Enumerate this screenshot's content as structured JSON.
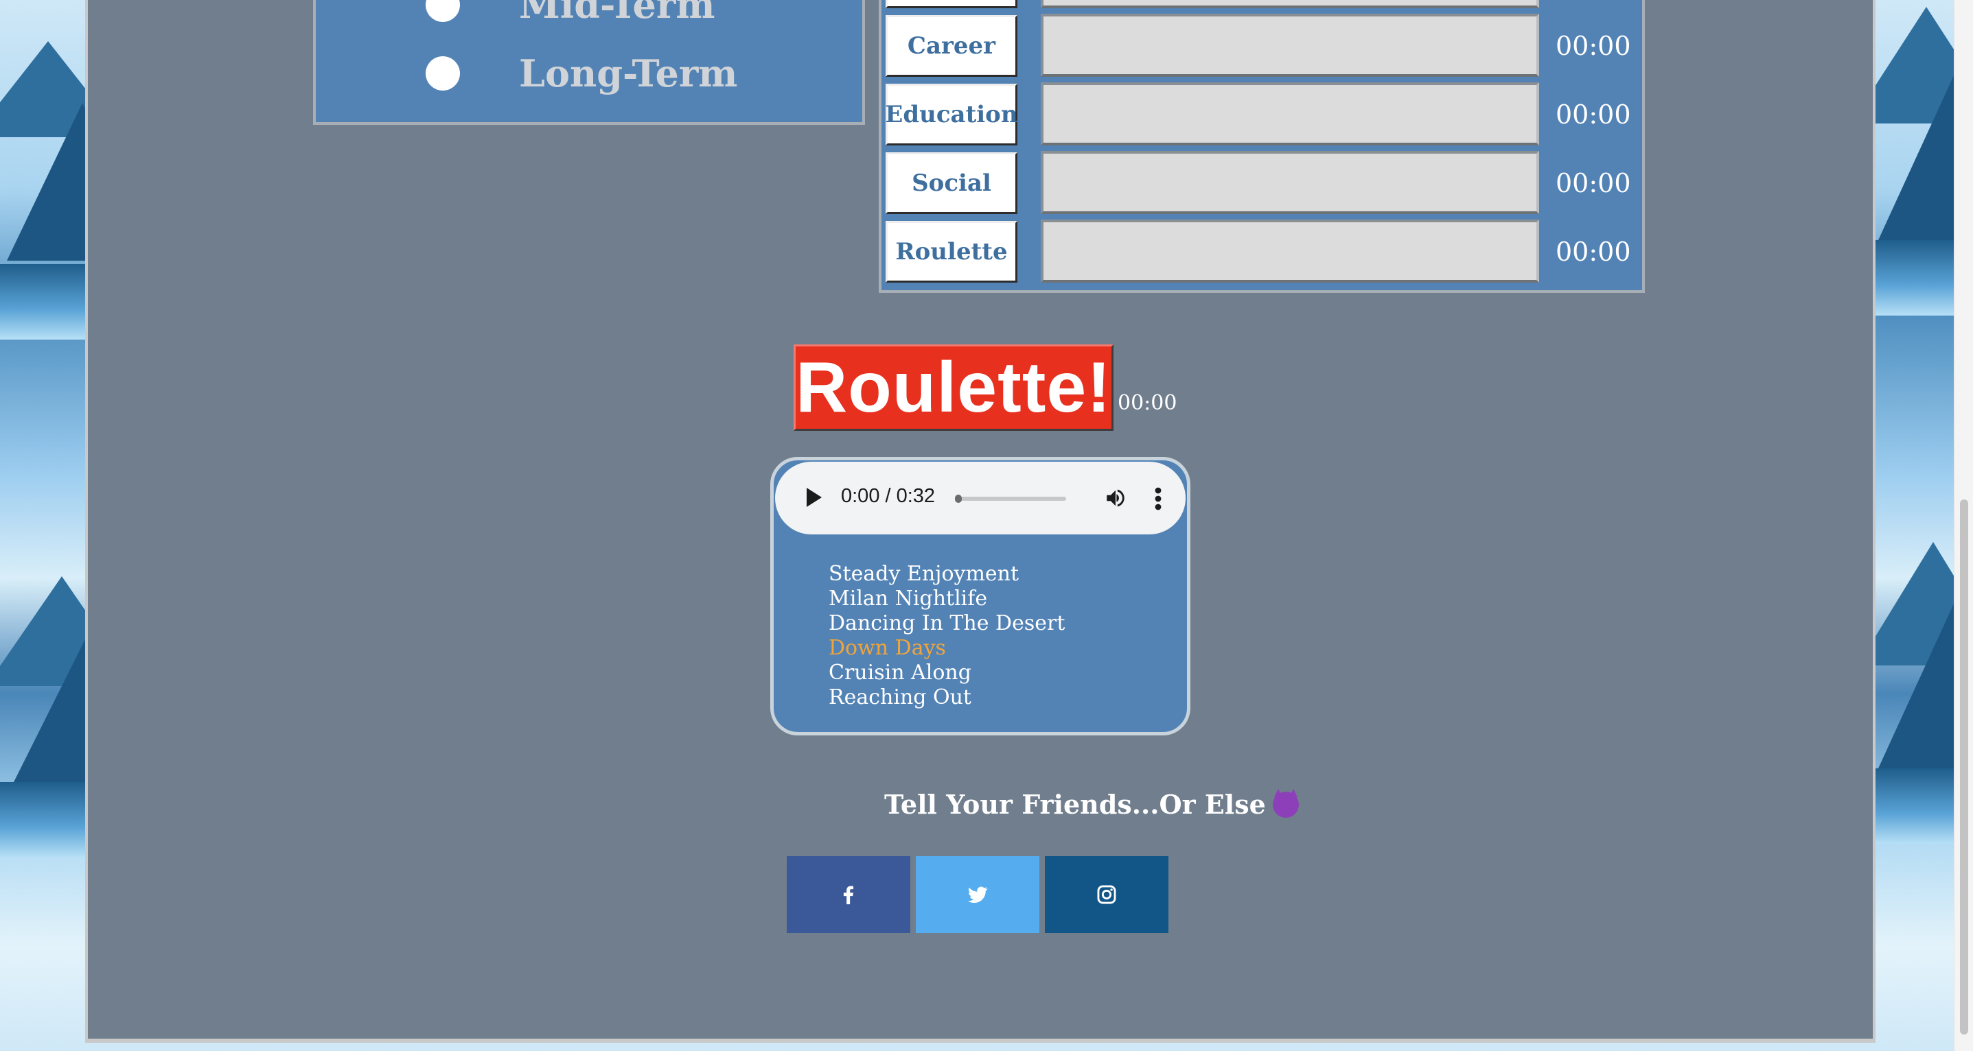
{
  "term_options": [
    {
      "label": "Mid-Term"
    },
    {
      "label": "Long-Term"
    }
  ],
  "categories": [
    {
      "label": "Career",
      "time": "00:00"
    },
    {
      "label": "Education",
      "time": "00:00"
    },
    {
      "label": "Social",
      "time": "00:00"
    },
    {
      "label": "Roulette",
      "time": "00:00"
    }
  ],
  "roulette": {
    "button_label": "Roulette!",
    "time": "00:00"
  },
  "player": {
    "time_display": "0:00 / 0:32",
    "progress": 0.0,
    "tracks": [
      {
        "title": "Steady Enjoyment",
        "active": false
      },
      {
        "title": "Milan Nightlife",
        "active": false
      },
      {
        "title": "Dancing In The Desert",
        "active": false
      },
      {
        "title": "Down Days",
        "active": true
      },
      {
        "title": "Cruisin Along",
        "active": false
      },
      {
        "title": "Reaching Out",
        "active": false
      }
    ]
  },
  "share": {
    "title": "Tell Your Friends...Or Else",
    "buttons": [
      {
        "name": "facebook",
        "icon": "facebook-icon",
        "color": "#3b5998"
      },
      {
        "name": "twitter",
        "icon": "twitter-icon",
        "color": "#55acee"
      },
      {
        "name": "instagram",
        "icon": "instagram-icon",
        "color": "#125688"
      }
    ]
  }
}
